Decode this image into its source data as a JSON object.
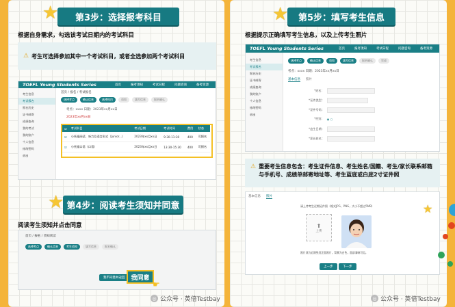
{
  "step3": {
    "badge": "第3步：选择报考科目",
    "heading": "根据自身需求，勾选该考试日期内的考试科目",
    "notice": "考生可选择参加其中一个考试科目，或者全选参加两个考试科目",
    "screenshot": {
      "brand": "TOEFL Young Students Series",
      "nav": [
        "首页",
        "报考须知",
        "考试日程",
        "问题咨询",
        "备考资源"
      ],
      "breadcrumb": "首页 / 报名 / 考试报名",
      "sidebar": [
        "考生信息",
        "考试报名",
        "报名历史",
        "证书邮寄",
        "成绩查询",
        "我的考试",
        "我的账户",
        "个人信息",
        "修改密码",
        "退出"
      ],
      "steps": [
        "选择考点",
        "确认信息",
        "选择科目",
        "须知",
        "填写信息",
        "报名确认"
      ],
      "info_lines": [
        "考点：xxxx 日期：2023年xx月xx日",
        "2023年xx月xx日"
      ],
      "table_headers": [
        "考试科目",
        "考试日期",
        "考试时间",
        "费用",
        "状态"
      ],
      "rows": [
        {
          "subject": "小托福阅读、听力及语言形式（Junior...）",
          "date": "2023年xx月xx日",
          "time": "9:30-11:30",
          "fee": "400",
          "status": "可报名"
        },
        {
          "subject": "小托福口语（口语）",
          "date": "2023年xx月xx日",
          "time": "13:30-15:30",
          "fee": "400",
          "status": "可报名"
        }
      ]
    }
  },
  "step4": {
    "badge": "第4步：阅读考生须知并同意",
    "heading": "阅读考生须知并点击同意",
    "screenshot": {
      "breadcrumb": "首页 / 报名 / 须知阅读",
      "steps": [
        "选择考点",
        "确认信息",
        "考生须知",
        "填写信息",
        "报名确认"
      ],
      "disagree": "我不同意并返回",
      "agree": "我同意"
    }
  },
  "step5": {
    "badge": "第5步：填写考生信息",
    "heading": "根据提示正确填写考生信息，以及上传考生照片",
    "screenshot": {
      "brand": "TOEFL Young Students Series",
      "nav": [
        "首页",
        "报考须知",
        "考试日程",
        "问题咨询",
        "备考资源"
      ],
      "sidebar": [
        "考生信息",
        "考试报名",
        "报名历史",
        "证书邮寄",
        "成绩查询",
        "我的账户",
        "个人信息",
        "修改密码",
        "退出"
      ],
      "steps": [
        "选择考点",
        "确认信息",
        "须知",
        "填写信息",
        "报名确认",
        "完成"
      ],
      "tabs": [
        "基本信息",
        "照片"
      ],
      "summary": "考点：xxxx 日期：2023年xx月xx日",
      "fields": [
        "*姓名：",
        "*证件类型：",
        "*证件号码：",
        "*性别：",
        "*出生日期：",
        "*家长姓名："
      ],
      "upload_hint": "请上传考生近期证件照（格式JPG、PNG，大小不超过5MB）",
      "upload_label": "上传",
      "photo_note": "照片须为近期免冠正面照片，背景为白色，面部清晰可见。",
      "prev": "上一步",
      "next": "下一步"
    },
    "notice": "重要考生信息包含：考生证件信息、考生姓名/国籍、考生/家长联系邮箱与手机号、成绩单邮寄地址等、考生蓝底或白底2寸证件照"
  },
  "watermark": "公众号 · 英倍Testbay"
}
